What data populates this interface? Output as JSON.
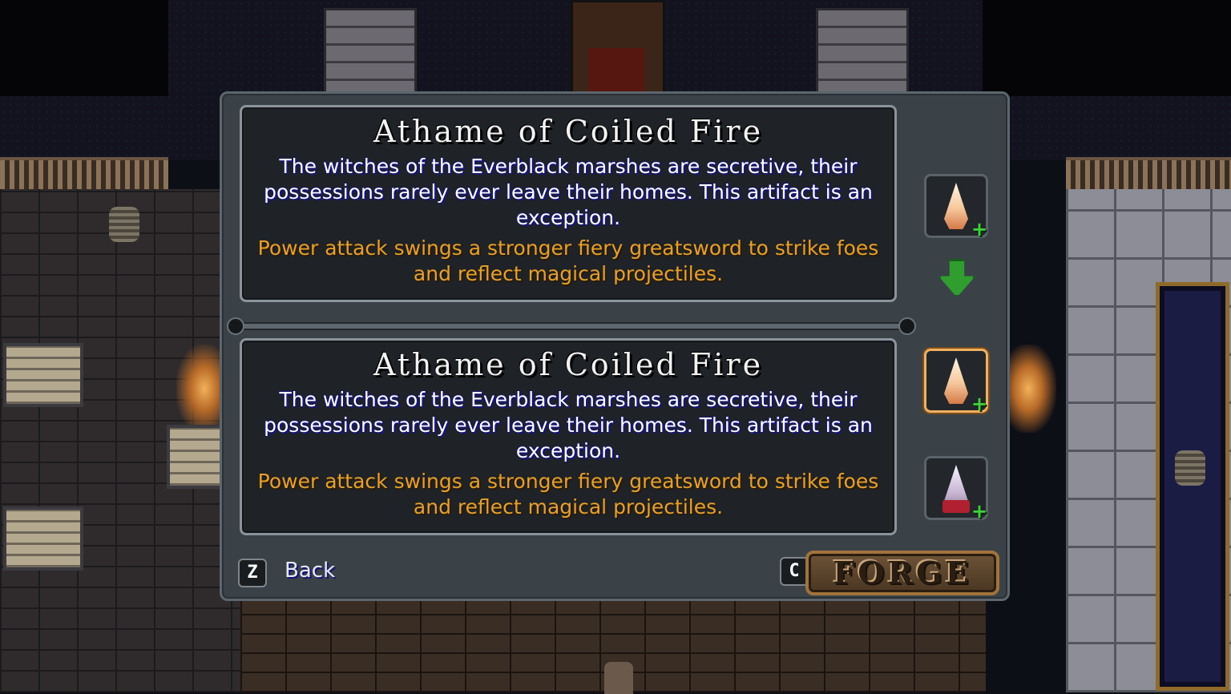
{
  "dialog": {
    "current_item": {
      "name": "Athame of Coiled Fire",
      "description": "The witches of the Everblack marshes are secretive, their possessions rarely ever leave their homes.   This artifact is an exception.",
      "effect": "Power attack swings a stronger fiery greatsword to strike foes and reflect magical projectiles."
    },
    "new_item": {
      "name": "Athame of Coiled Fire",
      "description": "The witches of the Everblack marshes are secretive, their possessions rarely ever leave their homes.   This artifact is an exception.",
      "effect": "Power attack swings a stronger fiery greatsword to strike foes and reflect magical projectiles."
    },
    "slots": [
      {
        "icon": "athame-icon",
        "badge": "+"
      },
      {
        "icon": "athame-icon",
        "badge": "+",
        "selected": true
      },
      {
        "icon": "silver-dagger-icon",
        "badge": "+"
      }
    ],
    "footer": {
      "back_key": "Z",
      "back_label": "Back",
      "forge_key": "C",
      "forge_label": "FORGE"
    }
  },
  "colors": {
    "effect_text": "#e6a126",
    "upgrade_plus": "#3fd23a",
    "selected_border": "#f0b060"
  }
}
